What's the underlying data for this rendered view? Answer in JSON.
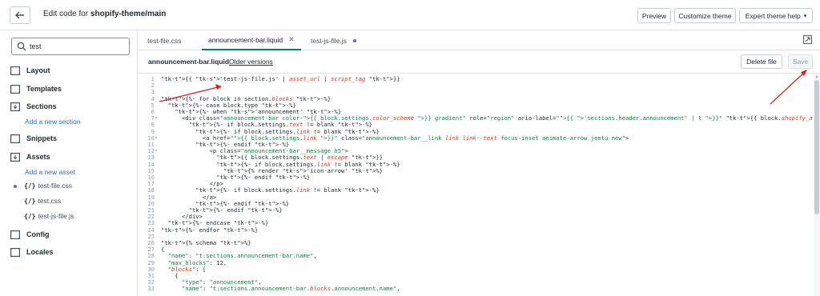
{
  "topbar": {
    "title_prefix": "Edit code for ",
    "title_theme": "shopify-theme/main",
    "preview": "Preview",
    "customize": "Customize theme",
    "expert_help": "Expert theme help",
    "expert_caret": "▾"
  },
  "sidebar": {
    "search_value": "test",
    "folders": {
      "layout": "Layout",
      "templates": "Templates",
      "sections": "Sections",
      "add_section": "Add a new section",
      "snippets": "Snippets",
      "assets": "Assets",
      "add_asset": "Add a new asset",
      "config": "Config",
      "locales": "Locales"
    },
    "files": [
      "test-file.css",
      "test.css",
      "test-js-file.js"
    ],
    "file_icon": "{/}"
  },
  "tabs": [
    "test-file.css",
    "announcement-bar.liquid",
    "test-js-file.js"
  ],
  "tab_close": "✕",
  "file_header": {
    "name": "announcement-bar.liquid",
    "older_versions": "Older versions",
    "delete": "Delete file",
    "save": "Save"
  },
  "code_lines": [
    {
      "n": "1",
      "fold": "",
      "code": "{{ 'test-js-file.js' | asset_url | script_tag }}"
    },
    {
      "n": "2",
      "fold": "",
      "code": ""
    },
    {
      "n": "3",
      "fold": "",
      "code": ""
    },
    {
      "n": "4",
      "fold": "",
      "code": "{%- for block in section.blocks -%}"
    },
    {
      "n": "5",
      "fold": "",
      "code": "  {%- case block.type -%}"
    },
    {
      "n": "6",
      "fold": "",
      "code": "    {%- when 'announcement' -%}"
    },
    {
      "n": "7",
      "fold": "▾",
      "code": "      <div class=\"announcement-bar color-{{ block.settings.color_scheme }} gradient\" role=\"region\" aria-label=\"{{ 'sections.header.announcement' | t }}\" {{ block.shopify_attr"
    },
    {
      "n": "8",
      "fold": "",
      "code": "        {%- if block.settings.text != blank -%}"
    },
    {
      "n": "9",
      "fold": "",
      "code": "          {%- if block.settings.link != blank -%}"
    },
    {
      "n": "10",
      "fold": "▾",
      "code": "            <a href=\"{{ block.settings.link }}\" class=\"announcement-bar__link link link--text focus-inset animate-arrow jeetu new\">"
    },
    {
      "n": "11",
      "fold": "",
      "code": "          {%- endif -%}"
    },
    {
      "n": "12",
      "fold": "▾",
      "code": "              <p class=\"announcement-bar__message h5\">"
    },
    {
      "n": "13",
      "fold": "",
      "code": "                {{ block.settings.text | escape }}"
    },
    {
      "n": "14",
      "fold": "",
      "code": "                {%- if block.settings.link != blank -%}"
    },
    {
      "n": "15",
      "fold": "",
      "code": "                  {% render 'icon-arrow' %}"
    },
    {
      "n": "16",
      "fold": "",
      "code": "                {%- endif -%}"
    },
    {
      "n": "17",
      "fold": "",
      "code": "              </p>"
    },
    {
      "n": "18",
      "fold": "",
      "code": "          {%- if block.settings.link != blank -%}"
    },
    {
      "n": "19",
      "fold": "",
      "code": "            </a>"
    },
    {
      "n": "20",
      "fold": "",
      "code": "          {%- endif -%}"
    },
    {
      "n": "21",
      "fold": "",
      "code": "        {%- endif -%}"
    },
    {
      "n": "22",
      "fold": "",
      "code": "      </div>"
    },
    {
      "n": "23",
      "fold": "",
      "code": "  {%- endcase -%}"
    },
    {
      "n": "24",
      "fold": "",
      "code": "{%- endfor -%}"
    },
    {
      "n": "25",
      "fold": "",
      "code": ""
    },
    {
      "n": "26",
      "fold": "",
      "code": "{% schema %}"
    },
    {
      "n": "27",
      "fold": "",
      "code": "{"
    },
    {
      "n": "28",
      "fold": "",
      "code": "  \"name\": \"t:sections.announcement-bar.name\","
    },
    {
      "n": "29",
      "fold": "",
      "code": "  \"max_blocks\": 12,"
    },
    {
      "n": "30",
      "fold": "",
      "code": "  \"blocks\": ["
    },
    {
      "n": "31",
      "fold": "",
      "code": "    {"
    },
    {
      "n": "32",
      "fold": "",
      "code": "      \"type\": \"announcement\","
    },
    {
      "n": "33",
      "fold": "",
      "code": "      \"name\": \"t:sections.announcement-bar.blocks.announcement.name\","
    }
  ],
  "colors": {
    "accent": "#008060",
    "link": "#2c6ecb",
    "annotation_arrow": "#e02020"
  }
}
